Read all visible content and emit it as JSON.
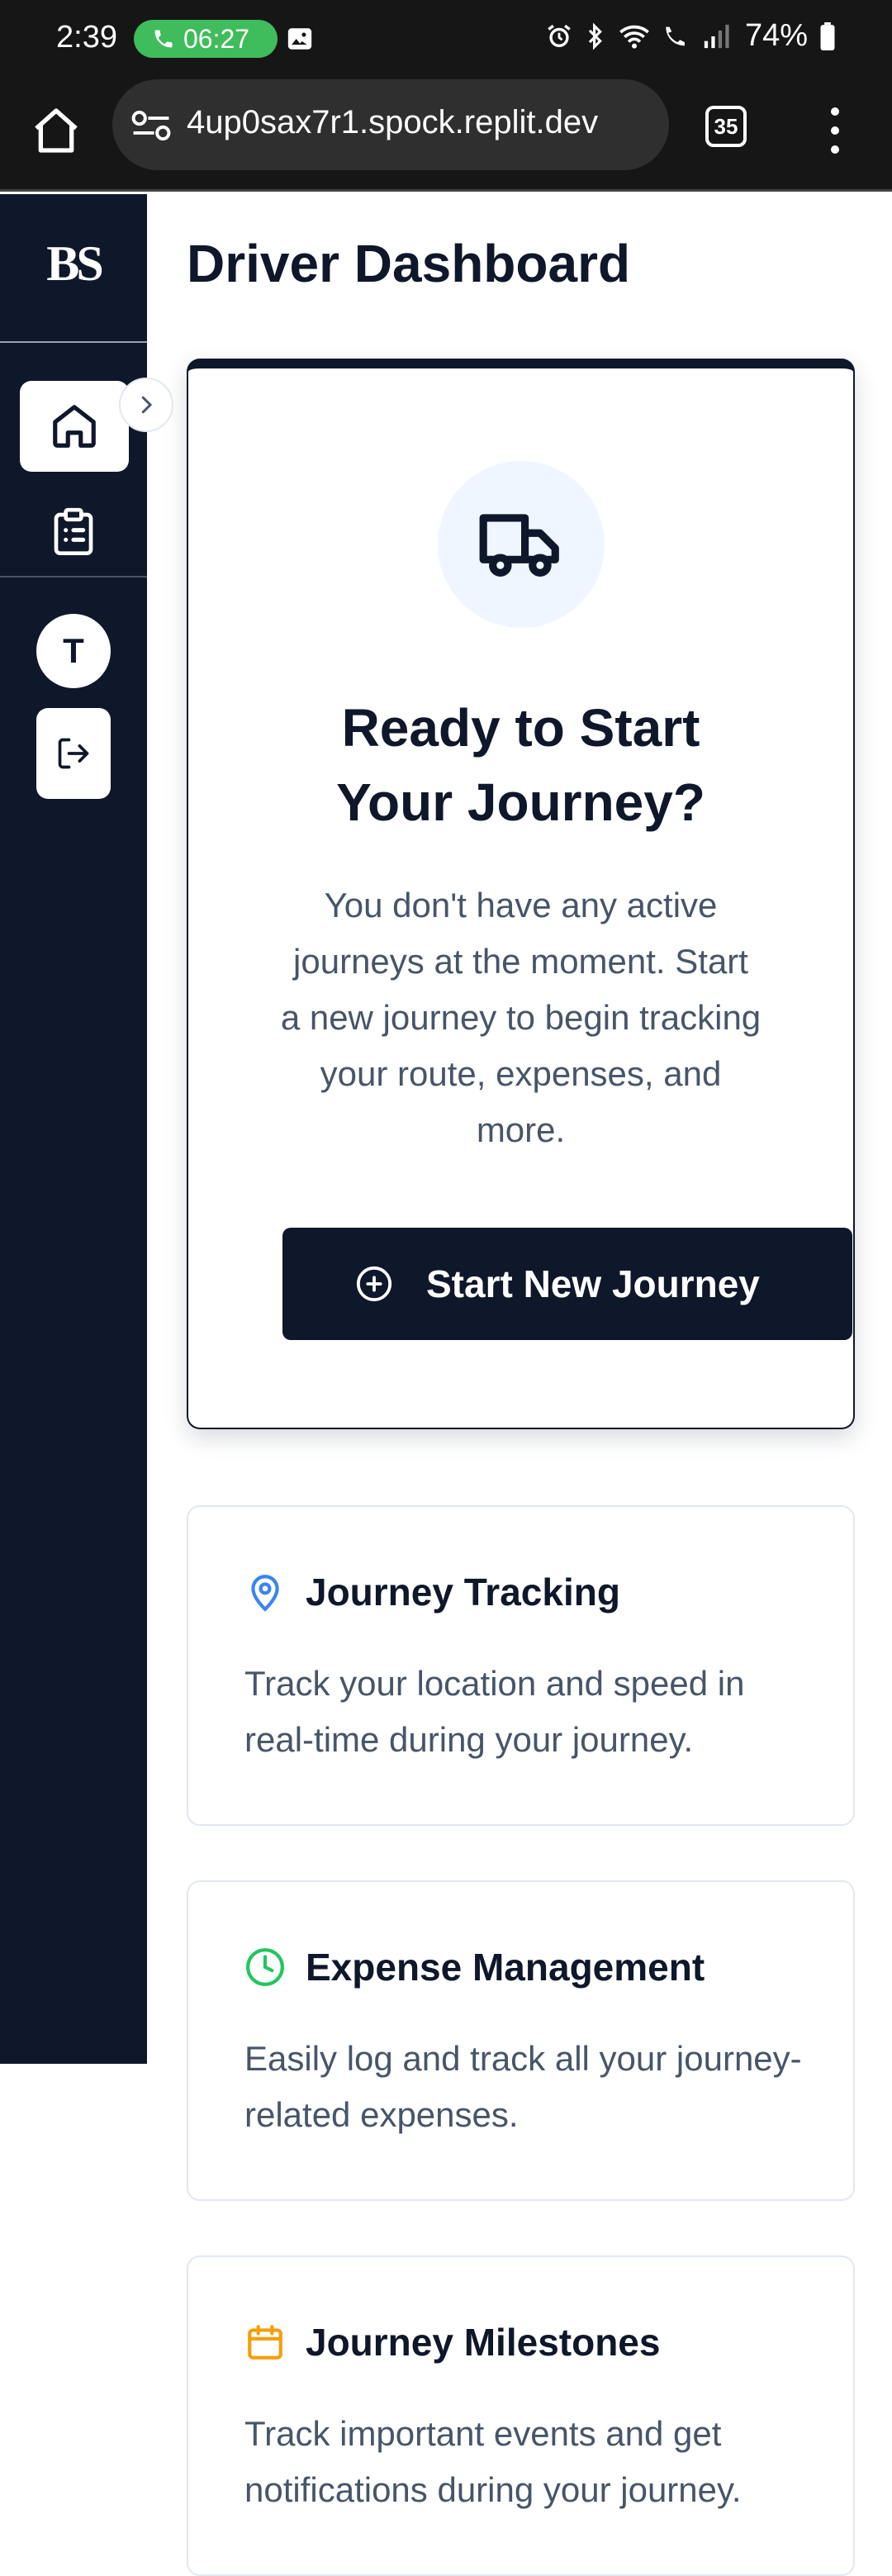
{
  "status_bar": {
    "time": "2:39",
    "call_timer": "06:27",
    "battery": "74%"
  },
  "browser": {
    "url": "4up0sax7r1.spock.replit.dev",
    "tab_count": "35"
  },
  "sidebar": {
    "logo": "BS",
    "avatar_initial": "T"
  },
  "main": {
    "page_title": "Driver Dashboard",
    "hero": {
      "title_line1": "Ready to Start",
      "title_line2": "Your Journey?",
      "description": "You don't have any active journeys at the moment. Start a new journey to begin tracking your route, expenses, and more.",
      "button_label": "Start New Journey"
    },
    "features": [
      {
        "title": "Journey Tracking",
        "description": "Track your location and speed in real-time during your journey.",
        "icon": "map-pin-icon",
        "color": "#3b82f6"
      },
      {
        "title": "Expense Management",
        "description": "Easily log and track all your journey-related expenses.",
        "icon": "clock-icon",
        "color": "#22c55e"
      },
      {
        "title": "Journey Milestones",
        "description": "Track important events and get notifications during your journey.",
        "icon": "calendar-icon",
        "color": "#f59e0b"
      }
    ]
  },
  "colors": {
    "sidebar_bg": "#0f172a",
    "primary": "#0f172a",
    "muted_text": "#475569",
    "call_green": "#3fbc5b"
  }
}
